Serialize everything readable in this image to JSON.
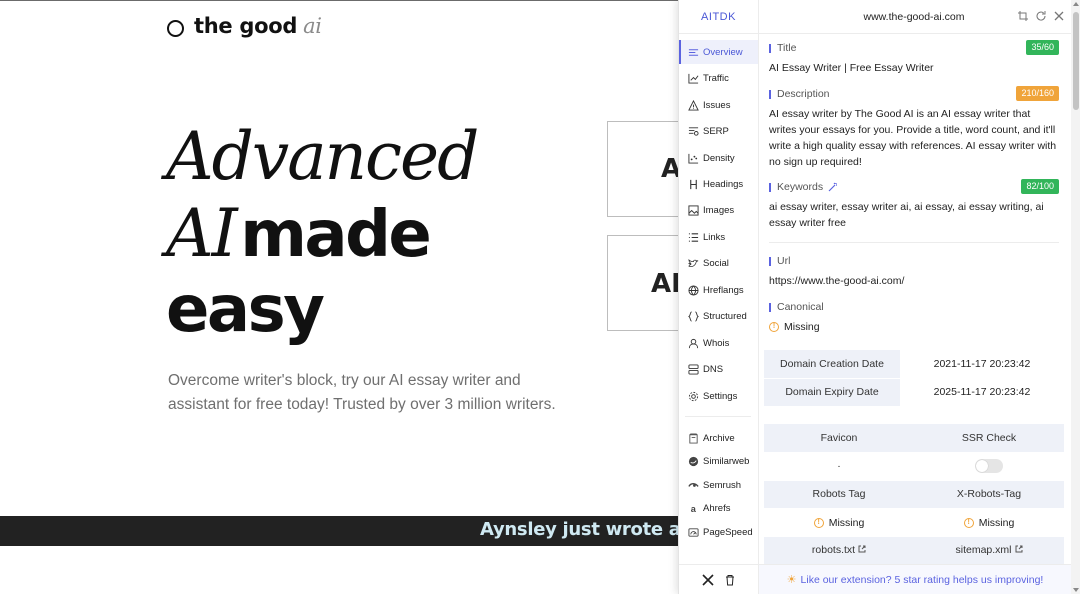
{
  "site": {
    "brand": "the good",
    "brand_suffix": "ai",
    "hero_line1": "Advanced",
    "hero_line2_italic": "AI",
    "hero_line2_rest": "made",
    "hero_line3": "easy",
    "subtitle": "Overcome writer's block, try our AI essay writer and assistant for free today! Trusted by over 3 million writers.",
    "card1_text": "A",
    "card2_text": "AI",
    "ticker": "Aynsley just wrote an es"
  },
  "ext": {
    "logo": "AITDK",
    "domain": "www.the-good-ai.com",
    "sidebar": [
      {
        "label": "Overview",
        "icon": "menu-lines-icon"
      },
      {
        "label": "Traffic",
        "icon": "chart-icon"
      },
      {
        "label": "Issues",
        "icon": "warning-triangle-icon"
      },
      {
        "label": "SERP",
        "icon": "serp-icon"
      },
      {
        "label": "Density",
        "icon": "scatter-icon"
      },
      {
        "label": "Headings",
        "icon": "heading-icon"
      },
      {
        "label": "Images",
        "icon": "image-icon"
      },
      {
        "label": "Links",
        "icon": "list-icon"
      },
      {
        "label": "Social",
        "icon": "bird-icon"
      },
      {
        "label": "Hreflangs",
        "icon": "globe-icon"
      },
      {
        "label": "Structured",
        "icon": "braces-icon"
      },
      {
        "label": "Whois",
        "icon": "user-icon"
      },
      {
        "label": "DNS",
        "icon": "server-icon"
      },
      {
        "label": "Settings",
        "icon": "gear-icon"
      }
    ],
    "sidebar_tools": [
      {
        "label": "Archive",
        "icon": "archive-icon"
      },
      {
        "label": "Similarweb",
        "icon": "similarweb-icon"
      },
      {
        "label": "Semrush",
        "icon": "semrush-icon"
      },
      {
        "label": "Ahrefs",
        "icon": "ahrefs-icon"
      },
      {
        "label": "PageSpeed",
        "icon": "speed-icon"
      }
    ],
    "title": {
      "label": "Title",
      "badge": "35/60",
      "value": "AI Essay Writer | Free Essay Writer"
    },
    "description": {
      "label": "Description",
      "badge": "210/160",
      "value": "AI essay writer by The Good AI is an AI essay writer that writes your essays for you. Provide a title, word count, and it'll write a high quality essay with references. AI essay writer with no sign up required!"
    },
    "keywords": {
      "label": "Keywords",
      "badge": "82/100",
      "value": "ai essay writer, essay writer ai, ai essay, ai essay writing, ai essay writer free"
    },
    "url": {
      "label": "Url",
      "value": "https://www.the-good-ai.com/"
    },
    "canonical": {
      "label": "Canonical",
      "value": "Missing"
    },
    "whois": [
      {
        "label": "Domain Creation Date",
        "value": "2021-11-17 20:23:42"
      },
      {
        "label": "Domain Expiry Date",
        "value": "2025-11-17 20:23:42"
      }
    ],
    "checks": {
      "favicon_label": "Favicon",
      "favicon_value": "·",
      "ssr_label": "SSR Check",
      "ssr_on": false,
      "robots_tag_label": "Robots Tag",
      "robots_tag_value": "Missing",
      "x_robots_label": "X-Robots-Tag",
      "x_robots_value": "Missing",
      "robots_txt": "robots.txt",
      "sitemap": "sitemap.xml"
    },
    "footer": "Like our extension? 5 star rating helps us improving!",
    "colors": {
      "accent": "#5b63e0",
      "badge_green": "#32b55a",
      "badge_orange": "#f0a43a"
    }
  }
}
